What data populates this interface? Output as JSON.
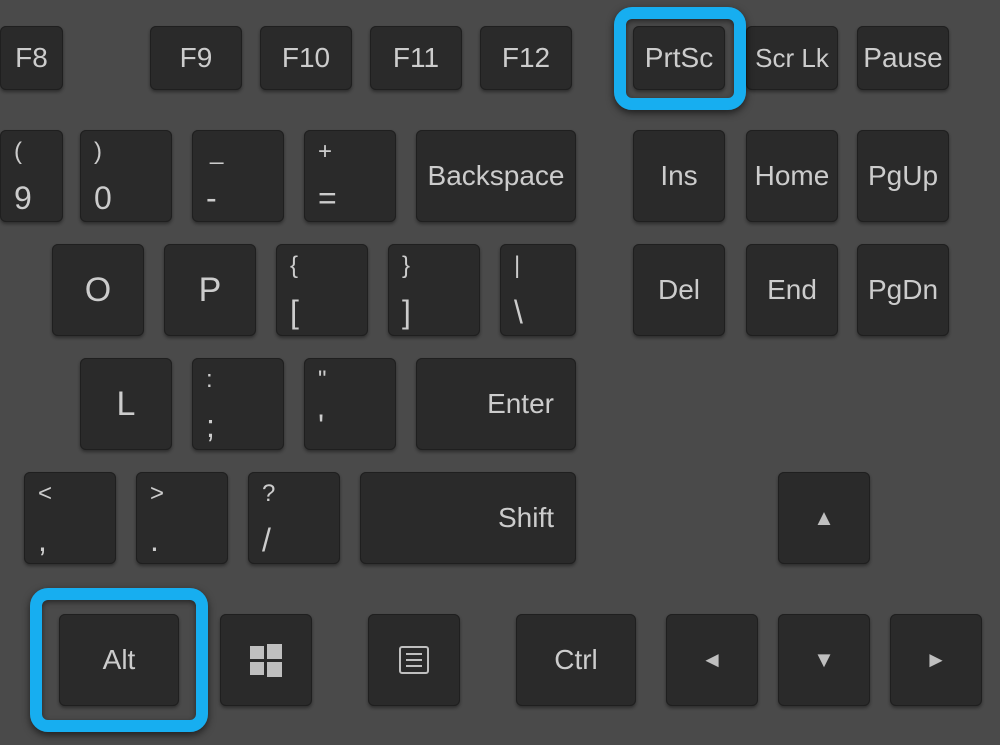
{
  "highlight_color": "#17aef0",
  "keys": {
    "f8": "F8",
    "f9": "F9",
    "f10": "F10",
    "f11": "F11",
    "f12": "F12",
    "prtsc": "PrtSc",
    "scrlk": "Scr Lk",
    "pause": "Pause",
    "nine_upper": "(",
    "nine_lower": "9",
    "zero_upper": ")",
    "zero_lower": "0",
    "minus_upper": "_",
    "minus_lower": "-",
    "equals_upper": "+",
    "equals_lower": "=",
    "backspace": "Backspace",
    "ins": "Ins",
    "home": "Home",
    "pgup": "PgUp",
    "o": "O",
    "p": "P",
    "bracket_l_upper": "{",
    "bracket_l_lower": "[",
    "bracket_r_upper": "}",
    "bracket_r_lower": "]",
    "backslash_upper": "|",
    "backslash_lower": "\\",
    "del": "Del",
    "end": "End",
    "pgdn": "PgDn",
    "l": "L",
    "semicolon_upper": ":",
    "semicolon_lower": ";",
    "quote_upper": "\"",
    "quote_lower": "'",
    "enter": "Enter",
    "comma_upper": "<",
    "comma_lower": ",",
    "period_upper": ">",
    "period_lower": ".",
    "slash_upper": "?",
    "slash_lower": "/",
    "shift": "Shift",
    "alt": "Alt",
    "ctrl": "Ctrl",
    "arrow_up": "▲",
    "arrow_left": "◄",
    "arrow_down": "▼",
    "arrow_right": "►"
  }
}
